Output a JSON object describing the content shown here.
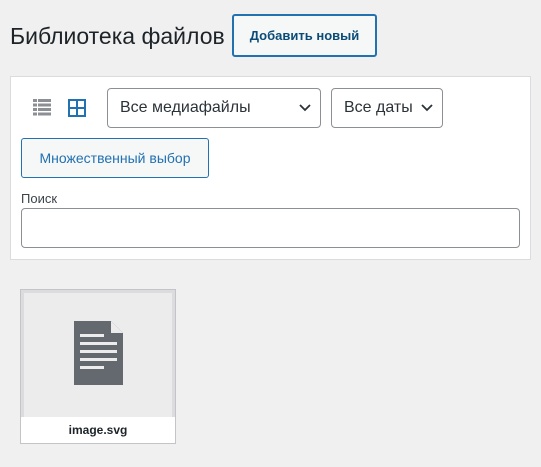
{
  "header": {
    "title": "Библиотека файлов",
    "add_new_label": "Добавить новый"
  },
  "toolbar": {
    "view_modes": [
      {
        "name": "list-view",
        "icon": "list-icon",
        "active": false
      },
      {
        "name": "grid-view",
        "icon": "grid-icon",
        "active": true
      }
    ],
    "media_filter": {
      "selected": "Все медиафайлы"
    },
    "date_filter": {
      "selected": "Все даты"
    },
    "bulk_select_label": "Множественный выбор",
    "search": {
      "label": "Поиск",
      "value": "",
      "placeholder": ""
    }
  },
  "attachments": [
    {
      "filename": "image.svg",
      "icon": "document-icon"
    }
  ],
  "colors": {
    "accent": "#2271b1",
    "accent_dark": "#0a4b78",
    "background": "#f0f0f1",
    "icon_inactive": "#8c8f94",
    "doc_icon": "#646970"
  }
}
